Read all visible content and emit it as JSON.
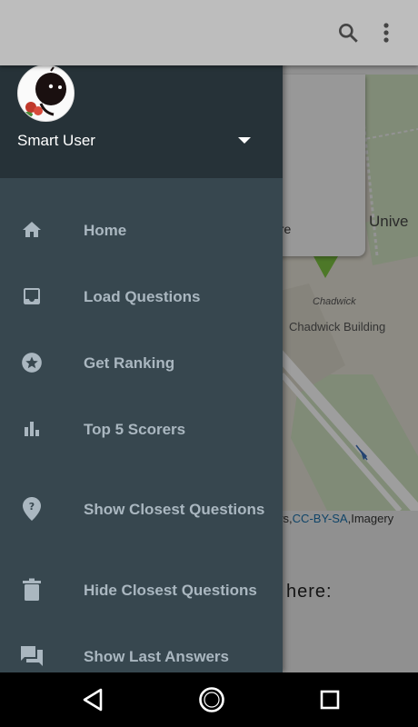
{
  "app": {
    "popup_text": "ere",
    "map_labels": {
      "university": "Unive",
      "chadwick_small": "Chadwick",
      "chadwick_building": "Chadwick Building"
    },
    "attribution": {
      "prefix": "ors,",
      "link": "CC-BY-SA",
      "suffix": ",Imagery"
    },
    "below_map_text": "here:"
  },
  "drawer": {
    "user_name": "Smart User",
    "items": [
      {
        "label": "Home",
        "icon": "home-icon"
      },
      {
        "label": "Load Questions",
        "icon": "inbox-icon"
      },
      {
        "label": "Get Ranking",
        "icon": "star-circle-icon"
      },
      {
        "label": "Top 5 Scorers",
        "icon": "bar-chart-icon"
      },
      {
        "label": "Show Closest Questions",
        "icon": "place-unknown-icon"
      },
      {
        "label": "Hide Closest Questions",
        "icon": "trash-icon"
      },
      {
        "label": "Show Last Answers",
        "icon": "forum-icon"
      }
    ]
  },
  "colors": {
    "drawer_bg": "#37474f",
    "header_bg": "#263238",
    "menu_text": "#aab7c0",
    "icon": "#aab7c0"
  }
}
